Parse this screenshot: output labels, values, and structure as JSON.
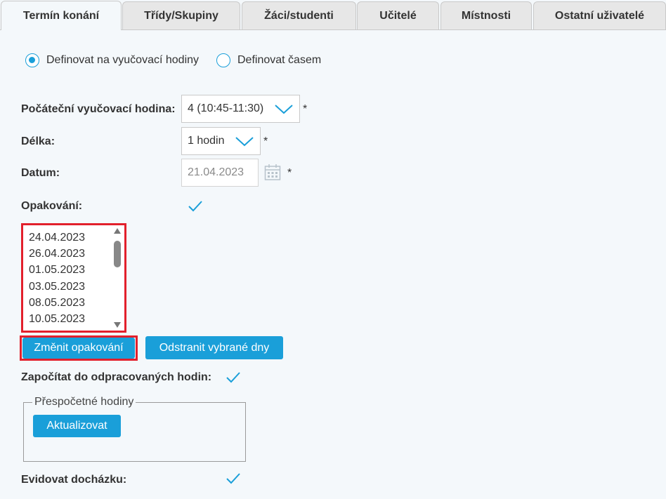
{
  "tabs": [
    {
      "label": "Termín konání",
      "active": true
    },
    {
      "label": "Třídy/Skupiny",
      "active": false
    },
    {
      "label": "Žáci/studenti",
      "active": false
    },
    {
      "label": "Učitelé",
      "active": false
    },
    {
      "label": "Místnosti",
      "active": false
    },
    {
      "label": "Ostatní uživatelé",
      "active": false
    }
  ],
  "mode": {
    "option_lessons": "Definovat na vyučovací hodiny",
    "option_time": "Definovat časem",
    "selected": "option_lessons"
  },
  "form": {
    "start_label": "Počáteční vyučovací hodina:",
    "start_value": "4 (10:45-11:30)",
    "length_label": "Délka:",
    "length_value": "1 hodin",
    "date_label": "Datum:",
    "date_value": "21.04.2023",
    "required_mark": "*",
    "repeat_label": "Opakování:",
    "repeat_checked": true
  },
  "repeat_dates": [
    "24.04.2023",
    "26.04.2023",
    "01.05.2023",
    "03.05.2023",
    "08.05.2023",
    "10.05.2023"
  ],
  "buttons": {
    "change_repeat": "Změnit opakování",
    "remove_days": "Odstranit vybrané dny",
    "update": "Aktualizovat"
  },
  "count_hours": {
    "label": "Započítat do odpracovaných hodin:",
    "checked": true
  },
  "recount": {
    "legend": "Přespočetné hodiny"
  },
  "attendance": {
    "label": "Evidovat docházku:",
    "checked": true
  },
  "colors": {
    "accent": "#1a9fd9",
    "highlight": "#e2202c",
    "background": "#f4f8fb"
  }
}
